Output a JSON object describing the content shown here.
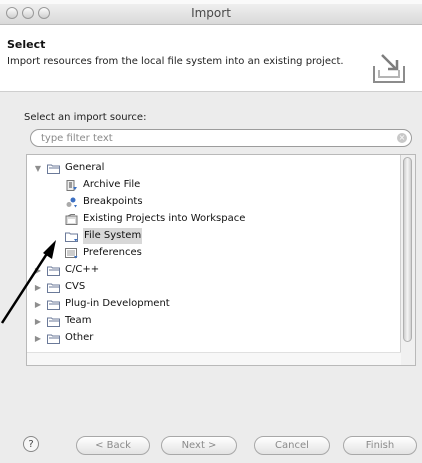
{
  "window": {
    "title": "Import"
  },
  "header": {
    "title": "Select",
    "description": "Import resources from the local file system into an existing project."
  },
  "source_label": "Select an import source:",
  "filter": {
    "placeholder": "type filter text",
    "value": ""
  },
  "tree": [
    {
      "label": "General",
      "level": 0,
      "expanded": true,
      "icon": "folder-icon",
      "selected": false
    },
    {
      "label": "Archive File",
      "level": 1,
      "icon": "archive-file-icon",
      "selected": false
    },
    {
      "label": "Breakpoints",
      "level": 1,
      "icon": "breakpoints-icon",
      "selected": false
    },
    {
      "label": "Existing Projects into Workspace",
      "level": 1,
      "icon": "existing-projects-icon",
      "selected": false
    },
    {
      "label": "File System",
      "level": 1,
      "icon": "file-system-icon",
      "selected": true
    },
    {
      "label": "Preferences",
      "level": 1,
      "icon": "preferences-icon",
      "selected": false
    },
    {
      "label": "C/C++",
      "level": 0,
      "expanded": false,
      "icon": "folder-icon",
      "selected": false
    },
    {
      "label": "CVS",
      "level": 0,
      "expanded": false,
      "icon": "folder-icon",
      "selected": false
    },
    {
      "label": "Plug-in Development",
      "level": 0,
      "expanded": false,
      "icon": "folder-icon",
      "selected": false
    },
    {
      "label": "Team",
      "level": 0,
      "expanded": false,
      "icon": "folder-icon",
      "selected": false
    },
    {
      "label": "Other",
      "level": 0,
      "expanded": false,
      "icon": "folder-icon",
      "selected": false
    }
  ],
  "buttons": {
    "help": "?",
    "back": "< Back",
    "next": "Next >",
    "cancel": "Cancel",
    "finish": "Finish"
  },
  "colors": {
    "selection": "#d8d8d8",
    "folder_outline": "#6b7a99",
    "arrow": "#000000"
  }
}
